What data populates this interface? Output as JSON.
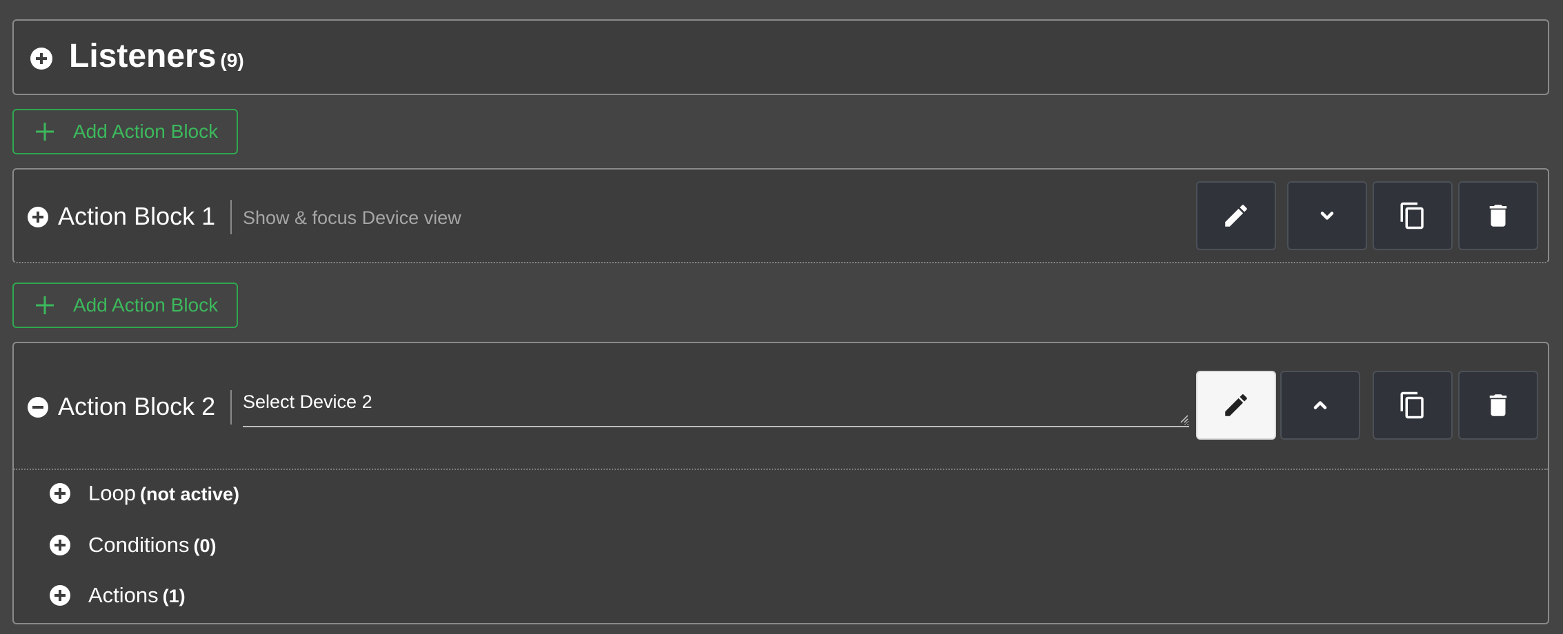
{
  "listeners": {
    "title": "Listeners",
    "count": "(9)"
  },
  "add_action_block_label": "Add Action Block",
  "action_blocks": [
    {
      "title": "Action Block 1",
      "description": "Show & focus Device view",
      "expanded": false
    },
    {
      "title": "Action Block 2",
      "name_value": "Select Device 2",
      "expanded": true,
      "sections": [
        {
          "label": "Loop",
          "status": "(not active)"
        },
        {
          "label": "Conditions",
          "status": "(0)"
        },
        {
          "label": "Actions",
          "status": "(1)"
        }
      ]
    }
  ],
  "icons": {
    "edit": "pencil-icon",
    "expand": "chevron-down-icon",
    "collapse": "chevron-up-icon",
    "duplicate": "copy-icon",
    "delete": "trash-icon"
  },
  "colors": {
    "background": "#444444",
    "panel": "#3d3d3d",
    "accent_green": "#3cb95c",
    "icon_button": "#30343a"
  }
}
